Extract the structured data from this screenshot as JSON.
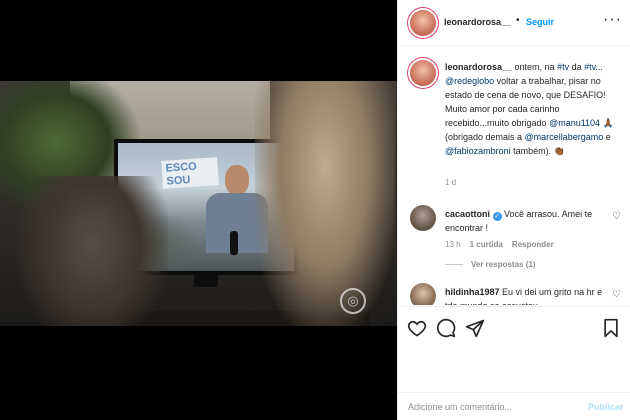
{
  "colors": {
    "link": "#00376b",
    "follow": "#0095f6",
    "post_disabled": "#b2dffc",
    "muted": "#8e8e8e"
  },
  "media": {
    "tv_banner_text": "ESCO\nSOU",
    "watermark_icon": "globoplay-logo-icon"
  },
  "header": {
    "username": "leonardorosa__",
    "separator": "•",
    "follow_label": "Seguir",
    "more_icon": "ellipsis-icon",
    "more_label": "···"
  },
  "caption": {
    "username": "leonardorosa__",
    "text_1": " ontem, na ",
    "tag_tv": "#tv",
    "text_2": " da ",
    "tag_tv2": "#tv...",
    "mention_redeglobo": " @redeglobo",
    "text_3": " voltar a trabalhar, pisar no estado de cena de novo, que DESAFIO! Muito amor por cada carinho recebido...muito obrigado ",
    "mention_manu": "@manu1104",
    "emoji_1": "🙏🏾",
    "text_4": " (obrigado demais a ",
    "mention_marcella": "@marcellabergamo",
    "text_5": " e ",
    "mention_fabio": "@fabiozambroni",
    "text_6": " também). ",
    "emoji_2": "👏🏾",
    "time": "1 d"
  },
  "comments": [
    {
      "username": "cacaottoni",
      "verified_icon": "verified-badge-icon",
      "text": " Você arrasou. Amei te encontrar !",
      "time": "13 h",
      "likes": "1 curtida",
      "reply_label": "Responder",
      "view_replies": "Ver respostas (1)"
    },
    {
      "username": "hildinha1987",
      "text": " Eu vi dei um grito na hr e tdo mundo se assustou"
    }
  ],
  "actions": {
    "like_icon": "heart-icon",
    "comment_icon": "comment-icon",
    "share_icon": "paper-plane-icon",
    "save_icon": "bookmark-icon"
  },
  "add_comment": {
    "placeholder": "Adicione um comentário...",
    "post_label": "Publicar"
  }
}
